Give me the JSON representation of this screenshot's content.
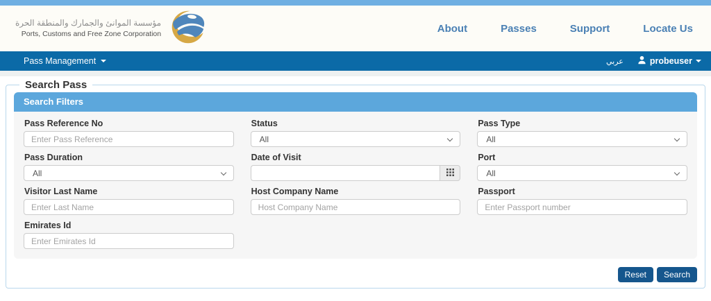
{
  "colors": {
    "top_strip": "#6fafe2",
    "navbar": "#0b6aa7",
    "panel_header": "#5ca7dc",
    "button": "#15568d",
    "nav_link": "#4a80b4",
    "fieldset_border": "#b9d7ec",
    "panel_body": "#f6f6f6"
  },
  "icons": {
    "brand_logo": "globe-swirl-blue-gold",
    "caret_down": "triangle-down",
    "user_icon": "person-silhouette",
    "select_chevron": "chevron-down",
    "calendar_grid": "3x3-grid"
  },
  "header": {
    "org_name_ar": "مؤسسة الموانئ والجمارك والمنطقة الحرة",
    "org_name_en": "Ports, Customs and Free Zone Corporation",
    "nav_items": [
      {
        "label": "About"
      },
      {
        "label": "Passes"
      },
      {
        "label": "Support"
      },
      {
        "label": "Locate Us"
      }
    ]
  },
  "navbar": {
    "menu": "Pass Management",
    "language": "عربي",
    "username": "probeuser"
  },
  "search": {
    "legend": "Search Pass",
    "filters_title": "Search Filters",
    "fields": [
      {
        "label": "Pass Reference No",
        "type": "text",
        "placeholder": "Enter Pass Reference",
        "value": ""
      },
      {
        "label": "Status",
        "type": "select",
        "value": "All"
      },
      {
        "label": "Pass Type",
        "type": "select",
        "value": "All"
      },
      {
        "label": "Pass Duration",
        "type": "select",
        "value": "All"
      },
      {
        "label": "Date of Visit",
        "type": "date",
        "value": ""
      },
      {
        "label": "Port",
        "type": "select",
        "value": "All"
      },
      {
        "label": "Visitor Last Name",
        "type": "text",
        "placeholder": "Enter Last Name",
        "value": ""
      },
      {
        "label": "Host Company Name",
        "type": "text",
        "placeholder": "Host Company Name",
        "value": ""
      },
      {
        "label": "Passport",
        "type": "text",
        "placeholder": "Enter Passport number",
        "value": ""
      },
      {
        "label": "Emirates Id",
        "type": "text",
        "placeholder": "Enter Emirates Id",
        "value": ""
      }
    ],
    "buttons": {
      "reset": "Reset",
      "search": "Search"
    }
  }
}
